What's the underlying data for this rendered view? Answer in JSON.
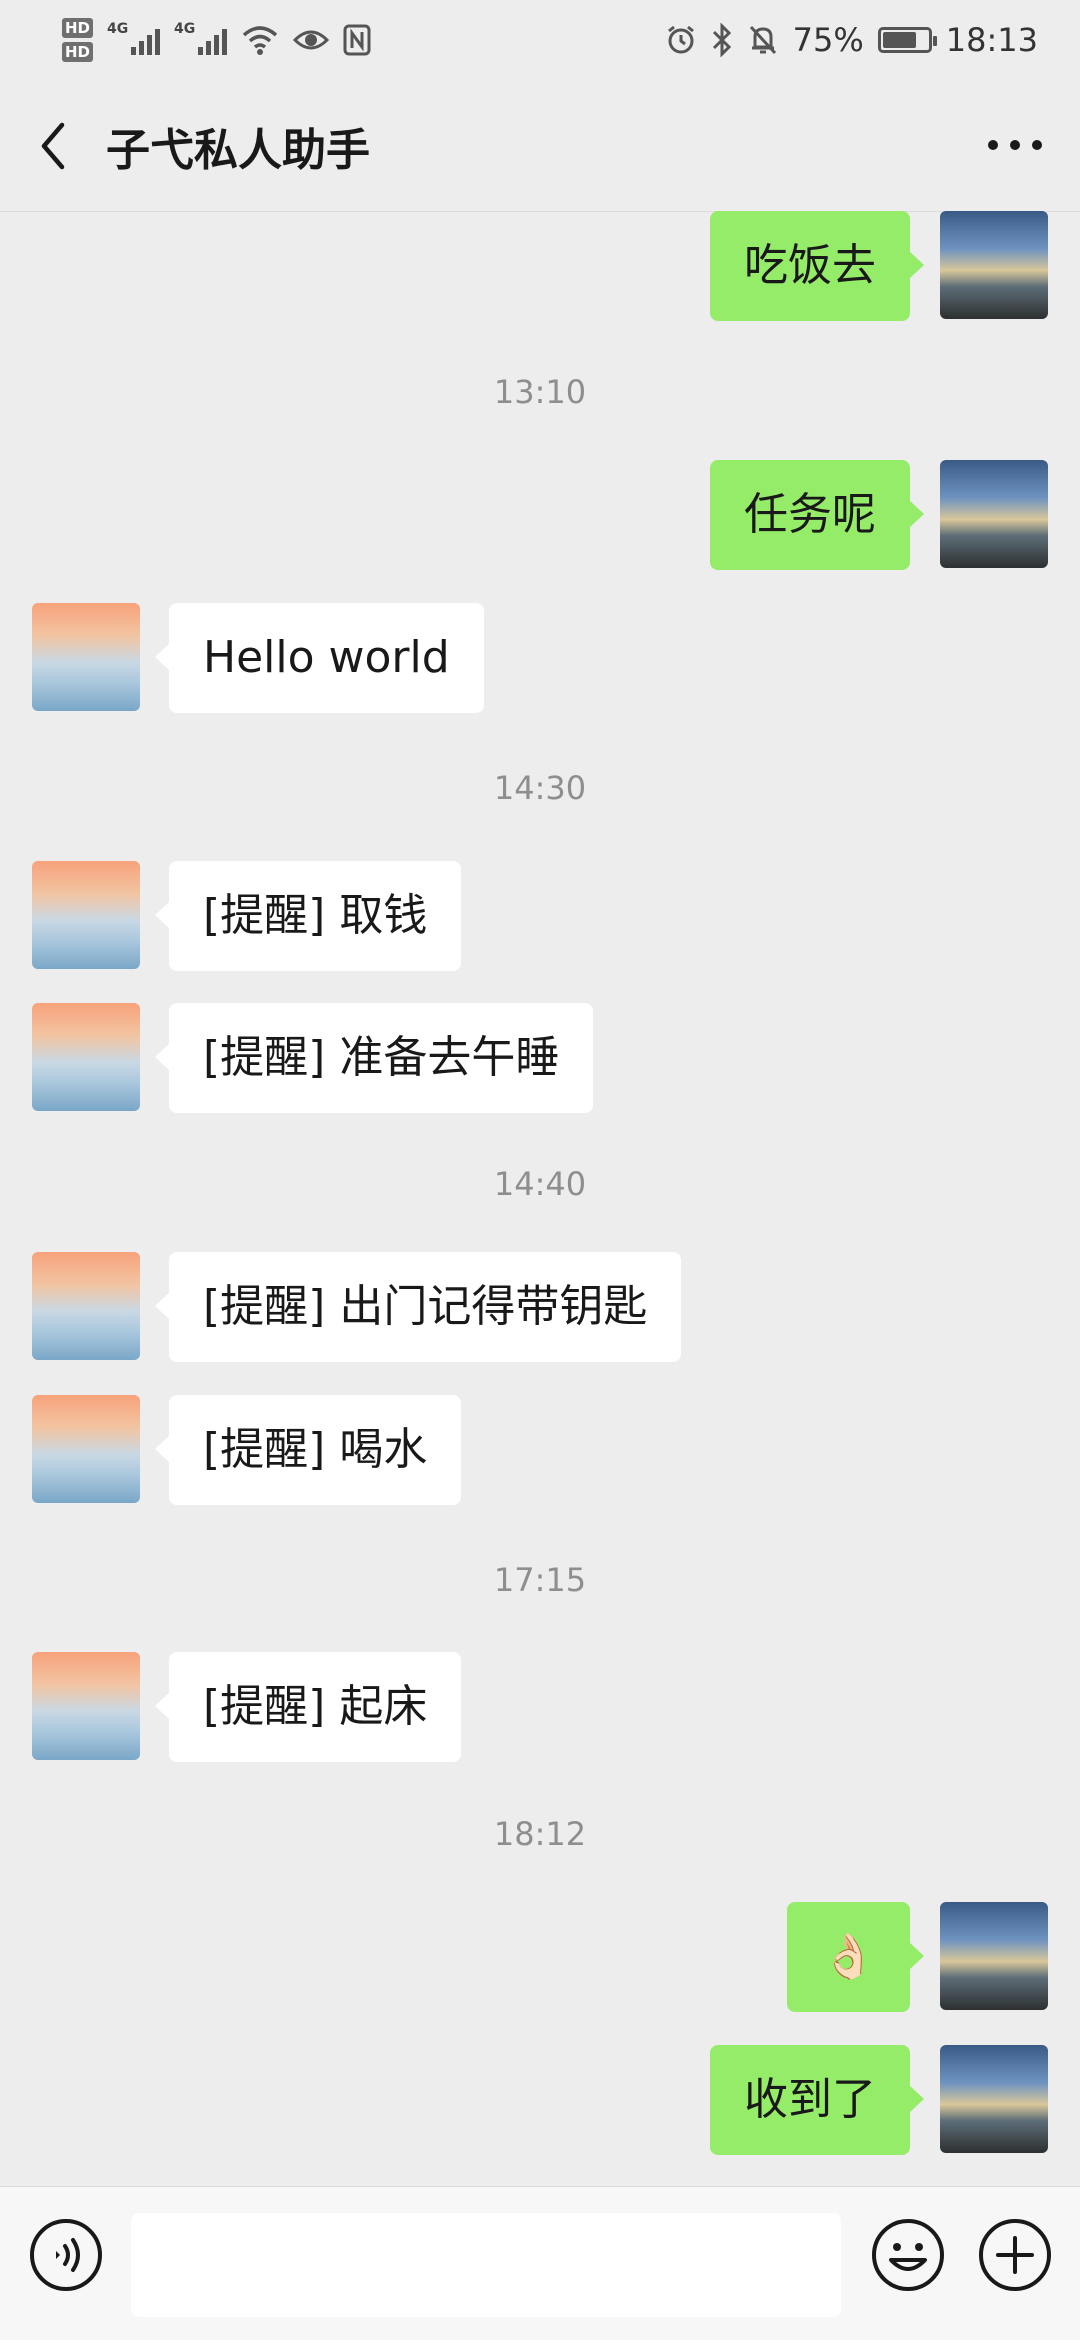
{
  "status_bar": {
    "hd_badge_1": "HD",
    "hd_badge_2": "HD",
    "network_1": "4G",
    "network_2": "4G",
    "battery_percent": "75%",
    "battery_level": 0.75,
    "time": "18:13"
  },
  "header": {
    "title": "子弋私人助手",
    "back_icon": "chevron-left-icon",
    "more_icon": "more-dots-icon"
  },
  "messages": [
    {
      "type": "bubble",
      "side": "right",
      "text": "吃饭去"
    },
    {
      "type": "time",
      "text": "13:10"
    },
    {
      "type": "bubble",
      "side": "right",
      "text": "任务呢"
    },
    {
      "type": "bubble",
      "side": "left",
      "text": "Hello world"
    },
    {
      "type": "time",
      "text": "14:30"
    },
    {
      "type": "bubble",
      "side": "left",
      "text": "[提醒]  取钱"
    },
    {
      "type": "bubble",
      "side": "left",
      "text": "[提醒]  准备去午睡"
    },
    {
      "type": "time",
      "text": "14:40"
    },
    {
      "type": "bubble",
      "side": "left",
      "text": "[提醒]  出门记得带钥匙"
    },
    {
      "type": "bubble",
      "side": "left",
      "text": "[提醒]  喝水"
    },
    {
      "type": "time",
      "text": "17:15"
    },
    {
      "type": "bubble",
      "side": "left",
      "text": "[提醒]  起床"
    },
    {
      "type": "time",
      "text": "18:12"
    },
    {
      "type": "bubble",
      "side": "right",
      "text": "👌🏻"
    },
    {
      "type": "bubble",
      "side": "right",
      "text": "收到了"
    }
  ],
  "input_bar": {
    "voice_icon": "voice-icon",
    "emoji_icon": "emoji-icon",
    "add_icon": "plus-circle-icon",
    "message_placeholder": ""
  },
  "colors": {
    "background": "#ededed",
    "self_bubble": "#95ec69",
    "other_bubble": "#ffffff",
    "timestamp": "#8e8e8e"
  }
}
